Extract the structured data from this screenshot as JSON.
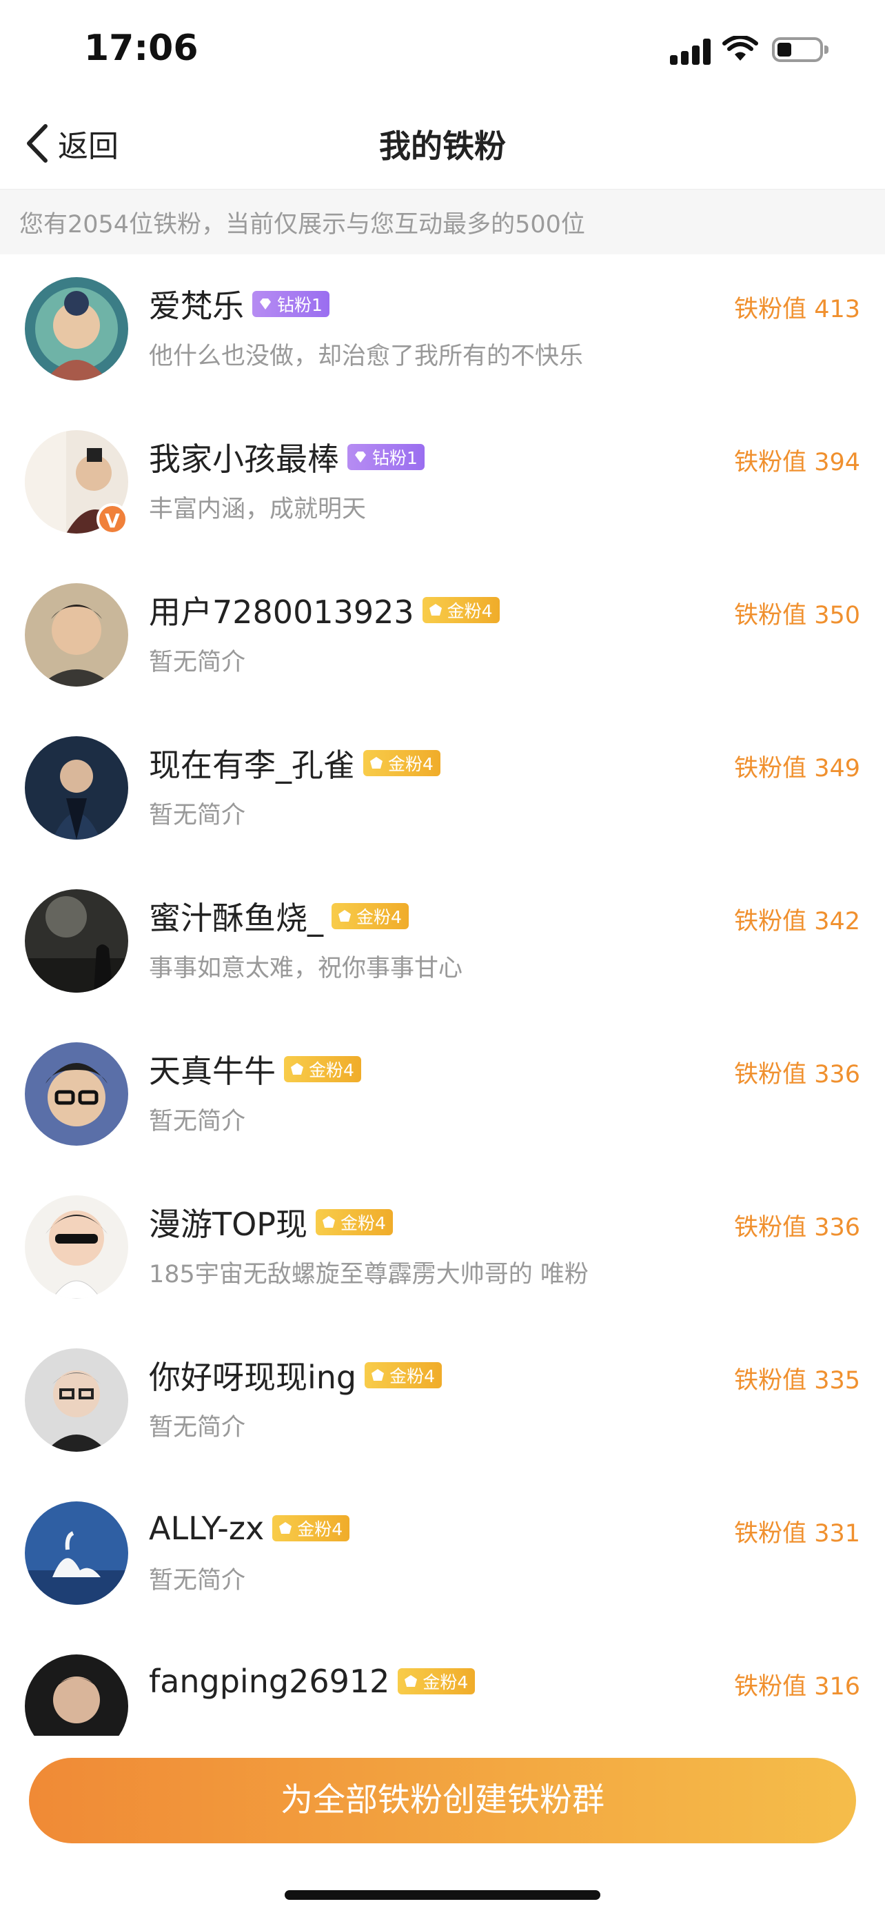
{
  "status_bar": {
    "time": "17:06"
  },
  "nav": {
    "back_label": "返回",
    "title": "我的铁粉"
  },
  "notice": "您有2054位铁粉，当前仅展示与您互动最多的500位",
  "fans": [
    {
      "name": "爱梵乐",
      "badge_type": "diamond",
      "badge": "钻粉1",
      "bio": "他什么也没做，却治愈了我所有的不快乐",
      "score": "铁粉值 413"
    },
    {
      "name": "我家小孩最棒",
      "badge_type": "diamond",
      "badge": "钻粉1",
      "bio": "丰富内涵，成就明天",
      "score": "铁粉值 394",
      "verified": "V"
    },
    {
      "name": "用户7280013923",
      "badge_type": "gold",
      "badge": "金粉4",
      "bio": "暂无简介",
      "score": "铁粉值 350"
    },
    {
      "name": "现在有李_孔雀",
      "badge_type": "gold",
      "badge": "金粉4",
      "bio": "暂无简介",
      "score": "铁粉值 349"
    },
    {
      "name": "蜜汁酥鱼烧_",
      "badge_type": "gold",
      "badge": "金粉4",
      "bio": "事事如意太难，祝你事事甘心",
      "score": "铁粉值 342"
    },
    {
      "name": "天真牛牛",
      "badge_type": "gold",
      "badge": "金粉4",
      "bio": "暂无简介",
      "score": "铁粉值 336"
    },
    {
      "name": "漫游TOP现",
      "badge_type": "gold",
      "badge": "金粉4",
      "bio": "185宇宙无敌螺旋至尊霹雳大帅哥的 唯粉",
      "score": "铁粉值 336"
    },
    {
      "name": "你好呀现现ing",
      "badge_type": "gold",
      "badge": "金粉4",
      "bio": "暂无简介",
      "score": "铁粉值 335"
    },
    {
      "name": "ALLY-zx",
      "badge_type": "gold",
      "badge": "金粉4",
      "bio": "暂无简介",
      "score": "铁粉值 331"
    },
    {
      "name": "fangping26912",
      "badge_type": "gold",
      "badge": "金粉4",
      "bio": "",
      "score": "铁粉值 316"
    }
  ],
  "bottom": {
    "button_label": "为全部铁粉创建铁粉群"
  },
  "colors": {
    "accent": "#f0902e",
    "diamond_badge": "#a57cf1",
    "gold_badge": "#f3b834",
    "button_start": "#f08a36",
    "button_end": "#f5bd4a"
  }
}
